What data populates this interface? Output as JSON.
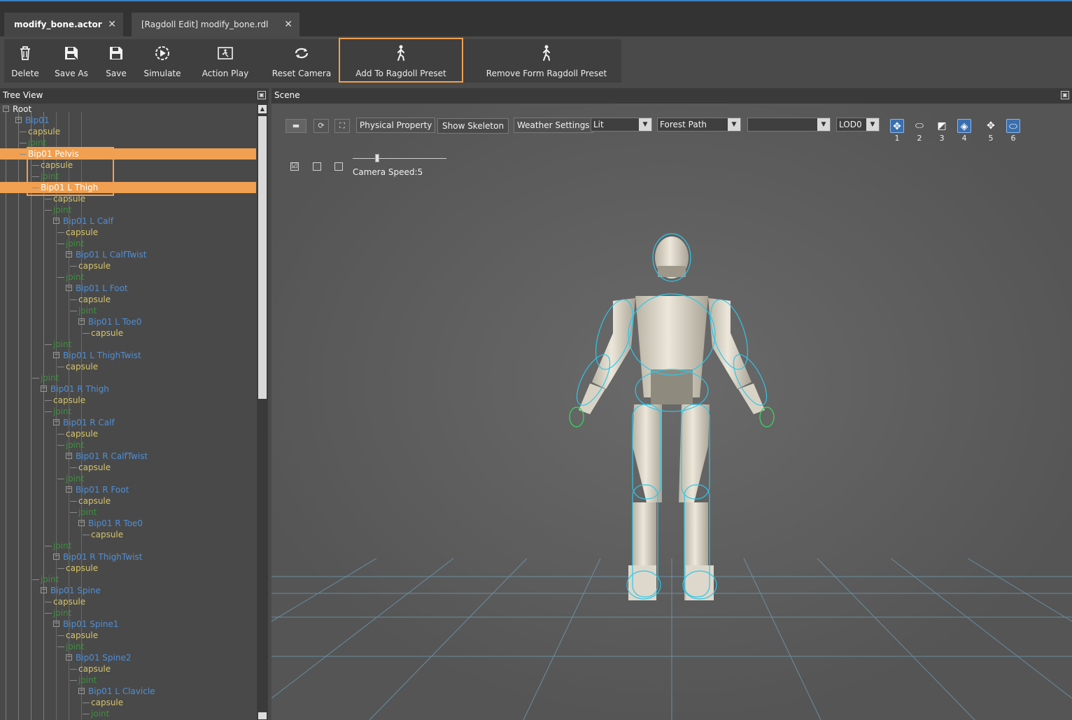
{
  "tabs": [
    {
      "label": "modify_bone.actor",
      "close": "✕"
    },
    {
      "label": "[Ragdoll Edit]  modify_bone.rdl",
      "close": "✕"
    }
  ],
  "toolbar": {
    "buttons": [
      {
        "label": "Delete",
        "icon": "trash-icon"
      },
      {
        "label": "Save As",
        "icon": "save-as-icon"
      },
      {
        "label": "Save",
        "icon": "save-icon"
      },
      {
        "label": "Simulate",
        "icon": "simulate-icon"
      },
      {
        "label": "Action Play",
        "icon": "action-play-icon"
      },
      {
        "label": "Reset Camera",
        "icon": "reset-camera-icon"
      },
      {
        "label": "Add To Ragdoll Preset",
        "icon": "walking-person-icon"
      },
      {
        "label": "Remove Form Ragdoll Preset",
        "icon": "walking-person-icon"
      }
    ]
  },
  "tree": {
    "title": "Tree View",
    "rows": [
      {
        "label": "Root",
        "kind": "root",
        "depth": 0,
        "toggle": true
      },
      {
        "label": "Bip01",
        "kind": "bone",
        "depth": 1,
        "toggle": true
      },
      {
        "label": "capsule",
        "kind": "capsule",
        "depth": 2
      },
      {
        "label": "joint",
        "kind": "joint",
        "depth": 2
      },
      {
        "label": "Bip01 Pelvis",
        "kind": "bone",
        "depth": 2,
        "selected": true
      },
      {
        "label": "capsule",
        "kind": "capsule",
        "depth": 3
      },
      {
        "label": "joint",
        "kind": "joint",
        "depth": 3
      },
      {
        "label": "Bip01 L Thigh",
        "kind": "bone",
        "depth": 3,
        "selected": true
      },
      {
        "label": "capsule",
        "kind": "capsule",
        "depth": 4
      },
      {
        "label": "joint",
        "kind": "joint",
        "depth": 4
      },
      {
        "label": "Bip01 L Calf",
        "kind": "bone",
        "depth": 4,
        "toggle": true
      },
      {
        "label": "capsule",
        "kind": "capsule",
        "depth": 5
      },
      {
        "label": "joint",
        "kind": "joint",
        "depth": 5
      },
      {
        "label": "Bip01 L CalfTwist",
        "kind": "bone",
        "depth": 5,
        "toggle": true
      },
      {
        "label": "capsule",
        "kind": "capsule",
        "depth": 6
      },
      {
        "label": "joint",
        "kind": "joint",
        "depth": 5
      },
      {
        "label": "Bip01 L Foot",
        "kind": "bone",
        "depth": 5,
        "toggle": true
      },
      {
        "label": "capsule",
        "kind": "capsule",
        "depth": 6
      },
      {
        "label": "joint",
        "kind": "joint",
        "depth": 6
      },
      {
        "label": "Bip01 L Toe0",
        "kind": "bone",
        "depth": 6,
        "toggle": true
      },
      {
        "label": "capsule",
        "kind": "capsule",
        "depth": 7
      },
      {
        "label": "joint",
        "kind": "joint",
        "depth": 4
      },
      {
        "label": "Bip01 L ThighTwist",
        "kind": "bone",
        "depth": 4,
        "toggle": true
      },
      {
        "label": "capsule",
        "kind": "capsule",
        "depth": 5
      },
      {
        "label": "joint",
        "kind": "joint",
        "depth": 3
      },
      {
        "label": "Bip01 R Thigh",
        "kind": "bone",
        "depth": 3,
        "toggle": true
      },
      {
        "label": "capsule",
        "kind": "capsule",
        "depth": 4
      },
      {
        "label": "joint",
        "kind": "joint",
        "depth": 4
      },
      {
        "label": "Bip01 R Calf",
        "kind": "bone",
        "depth": 4,
        "toggle": true
      },
      {
        "label": "capsule",
        "kind": "capsule",
        "depth": 5
      },
      {
        "label": "joint",
        "kind": "joint",
        "depth": 5
      },
      {
        "label": "Bip01 R CalfTwist",
        "kind": "bone",
        "depth": 5,
        "toggle": true
      },
      {
        "label": "capsule",
        "kind": "capsule",
        "depth": 6
      },
      {
        "label": "joint",
        "kind": "joint",
        "depth": 5
      },
      {
        "label": "Bip01 R Foot",
        "kind": "bone",
        "depth": 5,
        "toggle": true
      },
      {
        "label": "capsule",
        "kind": "capsule",
        "depth": 6
      },
      {
        "label": "joint",
        "kind": "joint",
        "depth": 6
      },
      {
        "label": "Bip01 R Toe0",
        "kind": "bone",
        "depth": 6,
        "toggle": true
      },
      {
        "label": "capsule",
        "kind": "capsule",
        "depth": 7
      },
      {
        "label": "joint",
        "kind": "joint",
        "depth": 4
      },
      {
        "label": "Bip01 R ThighTwist",
        "kind": "bone",
        "depth": 4,
        "toggle": true
      },
      {
        "label": "capsule",
        "kind": "capsule",
        "depth": 5
      },
      {
        "label": "joint",
        "kind": "joint",
        "depth": 3
      },
      {
        "label": "Bip01 Spine",
        "kind": "bone",
        "depth": 3,
        "toggle": true
      },
      {
        "label": "capsule",
        "kind": "capsule",
        "depth": 4
      },
      {
        "label": "joint",
        "kind": "joint",
        "depth": 4
      },
      {
        "label": "Bip01 Spine1",
        "kind": "bone",
        "depth": 4,
        "toggle": true
      },
      {
        "label": "capsule",
        "kind": "capsule",
        "depth": 5
      },
      {
        "label": "joint",
        "kind": "joint",
        "depth": 5
      },
      {
        "label": "Bip01 Spine2",
        "kind": "bone",
        "depth": 5,
        "toggle": true
      },
      {
        "label": "capsule",
        "kind": "capsule",
        "depth": 6
      },
      {
        "label": "joint",
        "kind": "joint",
        "depth": 6
      },
      {
        "label": "Bip01 L Clavicle",
        "kind": "bone",
        "depth": 6,
        "toggle": true
      },
      {
        "label": "capsule",
        "kind": "capsule",
        "depth": 7
      },
      {
        "label": "joint",
        "kind": "joint",
        "depth": 7
      }
    ]
  },
  "scene": {
    "title": "Scene",
    "buttons": {
      "physical_property": "Physical Property",
      "show_skeleton": "Show Skeleton",
      "weather_settings": "Weather Settings"
    },
    "selects": {
      "lighting": "Lit",
      "environment": "Forest Path",
      "empty": "",
      "lod": "LOD0"
    },
    "view_modes": [
      "1",
      "2",
      "3",
      "4",
      "5",
      "6"
    ],
    "camera_speed_label": "Camera Speed:5",
    "camera_speed": 5,
    "checkbox_checked": "☑"
  },
  "colors": {
    "accent": "#f0a050",
    "bone": "#4f8fd6",
    "capsule": "#d6c46a",
    "joint": "#3f8f3f",
    "grid": "#6fa0b8",
    "collider": "#2fc6e8"
  }
}
